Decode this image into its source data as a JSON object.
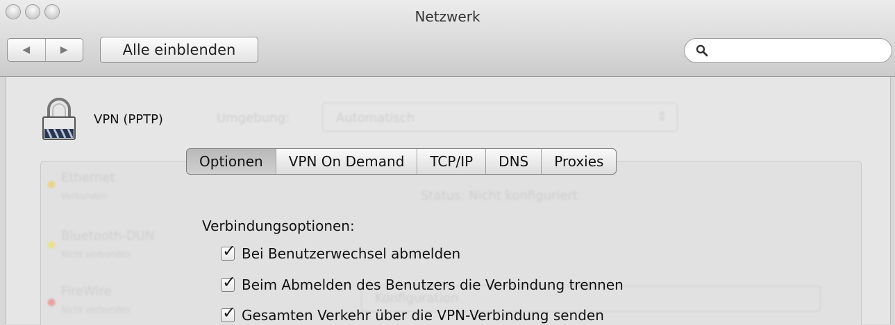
{
  "window": {
    "title": "Netzwerk"
  },
  "toolbar": {
    "back_glyph": "◀",
    "forward_glyph": "▶",
    "show_all_label": "Alle einblenden",
    "search_placeholder": ""
  },
  "service": {
    "name": "VPN (PPTP)",
    "icon": "lock-icon"
  },
  "background": {
    "location_label": "Umgebung:",
    "location_value": "Automatisch",
    "services": [
      {
        "name": "Ethernet",
        "sub": "Verbunden",
        "dot": "#e8d48a"
      },
      {
        "name": "Bluetooth-DUN",
        "sub": "Nicht verbunden",
        "dot": "#e8e28a"
      },
      {
        "name": "FireWire",
        "sub": "Nicht verbunden",
        "dot": "#e8a0a0"
      }
    ],
    "status_text": "Status: Nicht konfiguriert",
    "field_hint": "Konfiguration"
  },
  "tabs": [
    {
      "label": "Optionen",
      "selected": true
    },
    {
      "label": "VPN On Demand",
      "selected": false
    },
    {
      "label": "TCP/IP",
      "selected": false
    },
    {
      "label": "DNS",
      "selected": false
    },
    {
      "label": "Proxies",
      "selected": false
    }
  ],
  "options": {
    "section_label": "Verbindungsoptionen:",
    "items": [
      {
        "label": "Bei Benutzerwechsel abmelden",
        "checked": true
      },
      {
        "label": "Beim Abmelden des Benutzers die Verbindung trennen",
        "checked": true
      },
      {
        "label": "Gesamten Verkehr über die VPN-Verbindung senden",
        "checked": true
      }
    ]
  }
}
